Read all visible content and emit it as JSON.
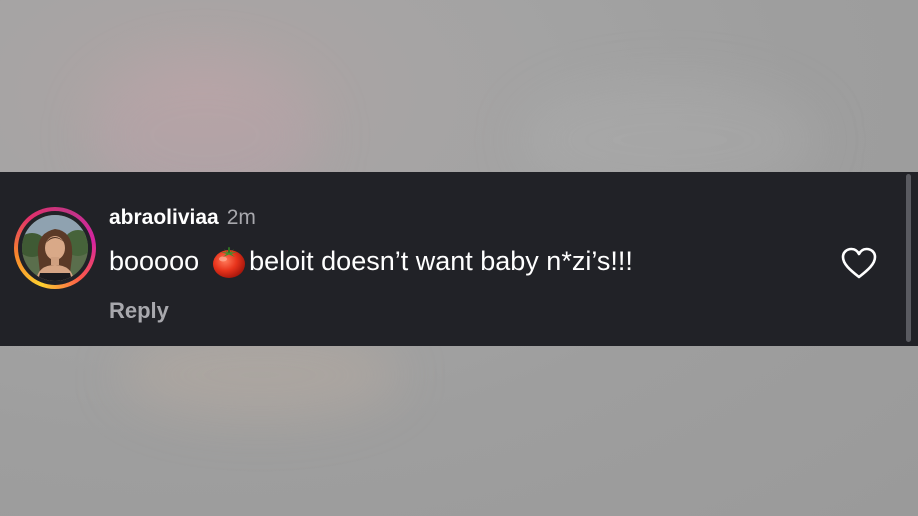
{
  "comment": {
    "username": "abraoliviaa",
    "timestamp": "2m",
    "text_before_emoji": "booooo",
    "emoji": "tomato-emoji",
    "text_after_emoji": "beloit doesn’t want baby n*zi’s!!!",
    "reply_label": "Reply",
    "like_icon": "heart-outline-icon"
  },
  "colors": {
    "strip_background": "#212227",
    "primary_text": "#ffffff",
    "secondary_text": "#a8a8ad",
    "story_ring": [
      "#fdd130",
      "#f8862c",
      "#e1306c",
      "#c13584"
    ]
  }
}
